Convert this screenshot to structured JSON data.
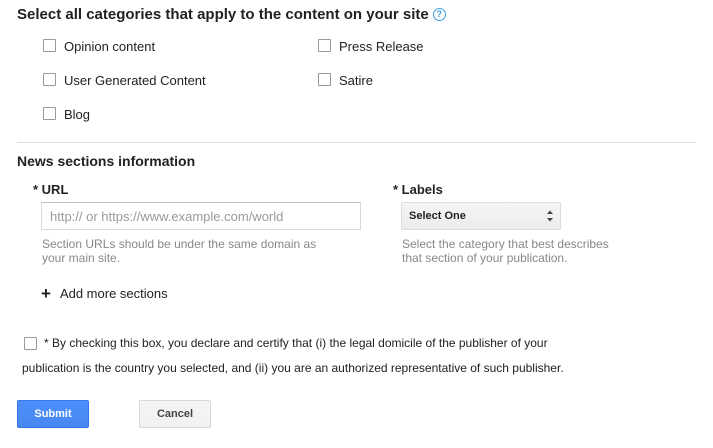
{
  "categories": {
    "heading": "Select all categories that apply to the content on your site",
    "help_icon": "question-circle-icon",
    "options": [
      {
        "label": "Opinion content",
        "checked": false
      },
      {
        "label": "User Generated Content",
        "checked": false
      },
      {
        "label": "Blog",
        "checked": false
      },
      {
        "label": "Press Release",
        "checked": false
      },
      {
        "label": "Satire",
        "checked": false
      }
    ]
  },
  "news_sections": {
    "heading": "News sections information",
    "url": {
      "label": "* URL",
      "value": "",
      "placeholder": "http:// or https://www.example.com/world",
      "hint_line1": "Section URLs should be under the same domain as",
      "hint_line2": "your main site."
    },
    "labels": {
      "label": "* Labels",
      "selected": "Select One",
      "hint_line1": "Select the category that best describes",
      "hint_line2": "that section of your publication."
    },
    "add_more": {
      "icon": "plus-icon",
      "label": "Add more sections"
    }
  },
  "declaration": {
    "checked": false,
    "line1": "* By checking this box, you declare and certify that (i) the legal domicile of the publisher of your",
    "line2": "publication is the country you selected, and (ii) you are an authorized representative of such publisher."
  },
  "actions": {
    "submit_label": "Submit",
    "cancel_label": "Cancel",
    "primary_color": "#4d90fe"
  }
}
